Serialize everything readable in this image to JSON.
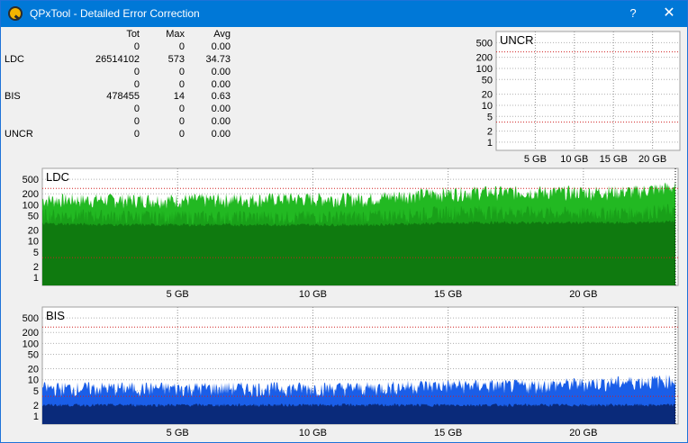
{
  "window": {
    "title": "QPxTool - Detailed Error Correction",
    "help_label": "?",
    "close_label": "✕",
    "app_icon": "qpxtool-icon",
    "accent": "#0078d7"
  },
  "stats": {
    "headers": [
      "",
      "Tot",
      "Max",
      "Avg"
    ],
    "rows": [
      [
        "",
        "0",
        "0",
        "0.00"
      ],
      [
        "LDC",
        "26514102",
        "573",
        "34.73"
      ],
      [
        "",
        "0",
        "0",
        "0.00"
      ],
      [
        "",
        "0",
        "0",
        "0.00"
      ],
      [
        "BIS",
        "478455",
        "14",
        "0.63"
      ],
      [
        "",
        "0",
        "0",
        "0.00"
      ],
      [
        "",
        "0",
        "0",
        "0.00"
      ],
      [
        "UNCR",
        "0",
        "0",
        "0.00"
      ]
    ]
  },
  "chart_data": [
    {
      "type": "area",
      "title": "UNCR",
      "y_scale": "log",
      "y_ticks": [
        "500",
        "200",
        "100",
        "50",
        "20",
        "10",
        "5",
        "2",
        "1"
      ],
      "x_ticks": [
        "5 GB",
        "10 GB",
        "15 GB",
        "20 GB"
      ],
      "xlim": [
        0,
        23.5
      ],
      "series": [
        {
          "values": [
            0,
            0,
            0
          ]
        }
      ]
    },
    {
      "type": "area",
      "title": "LDC",
      "y_scale": "log",
      "y_ticks": [
        "500",
        "200",
        "100",
        "50",
        "20",
        "10",
        "5",
        "2",
        "1"
      ],
      "x_ticks": [
        "5 GB",
        "10 GB",
        "15 GB",
        "20 GB"
      ],
      "xlim": [
        0,
        23.5
      ],
      "x": [
        0,
        3,
        6,
        9,
        12,
        14,
        16,
        18,
        20,
        22,
        23.4
      ],
      "series": [
        {
          "values": [
            140,
            140,
            140,
            150,
            150,
            200,
            230,
            230,
            230,
            240,
            320
          ],
          "color": "#22b922"
        },
        {
          "values": [
            55,
            50,
            48,
            48,
            50,
            60,
            70,
            65,
            60,
            65,
            75
          ],
          "color": "#19a019"
        },
        {
          "values": [
            30,
            28,
            28,
            28,
            28,
            30,
            32,
            32,
            32,
            32,
            35
          ],
          "color": "#0f7a0f"
        }
      ],
      "threshold": 280
    },
    {
      "type": "area",
      "title": "BIS",
      "y_scale": "log",
      "y_ticks": [
        "500",
        "200",
        "100",
        "50",
        "20",
        "10",
        "5",
        "2",
        "1"
      ],
      "x_ticks": [
        "5 GB",
        "10 GB",
        "15 GB",
        "20 GB"
      ],
      "xlim": [
        0,
        23.5
      ],
      "x": [
        0,
        3,
        6,
        9,
        12,
        14,
        16,
        18,
        20,
        22,
        23.4
      ],
      "series": [
        {
          "values": [
            6,
            6,
            6,
            6,
            6,
            7,
            7,
            7,
            8,
            9,
            10
          ],
          "color": "#1a5ee8"
        },
        {
          "values": [
            2,
            2,
            2,
            2,
            2,
            2,
            2,
            2,
            2,
            2,
            2
          ],
          "color": "#0a2a7a"
        }
      ],
      "threshold": 280
    }
  ]
}
